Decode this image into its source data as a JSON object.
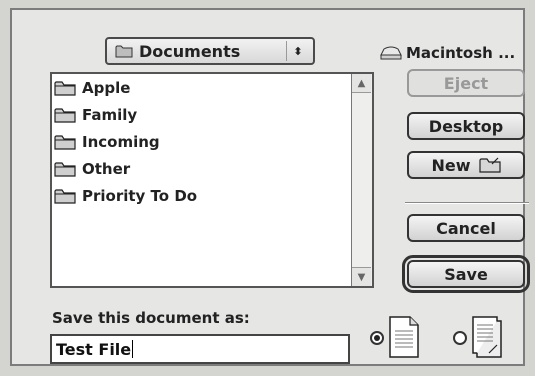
{
  "location_popup": {
    "label": "Documents",
    "icon": "folder-icon"
  },
  "volume": {
    "name": "Macintosh ...",
    "icon": "hard-disk-icon"
  },
  "file_list": {
    "items": [
      {
        "label": "Apple",
        "icon": "folder-icon"
      },
      {
        "label": "Family",
        "icon": "folder-icon"
      },
      {
        "label": "Incoming",
        "icon": "folder-icon"
      },
      {
        "label": "Other",
        "icon": "folder-icon"
      },
      {
        "label": "Priority To Do",
        "icon": "folder-icon"
      }
    ]
  },
  "buttons": {
    "eject": "Eject",
    "desktop": "Desktop",
    "new": "New",
    "cancel": "Cancel",
    "save": "Save"
  },
  "save_prompt": "Save this document as:",
  "filename_value": "Test File",
  "format_options": [
    {
      "icon": "document-icon",
      "selected": true
    },
    {
      "icon": "stationery-icon",
      "selected": false
    }
  ],
  "colors": {
    "dialog_bg": "#e6e6e4",
    "border": "#333333",
    "disabled_text": "#999999"
  }
}
